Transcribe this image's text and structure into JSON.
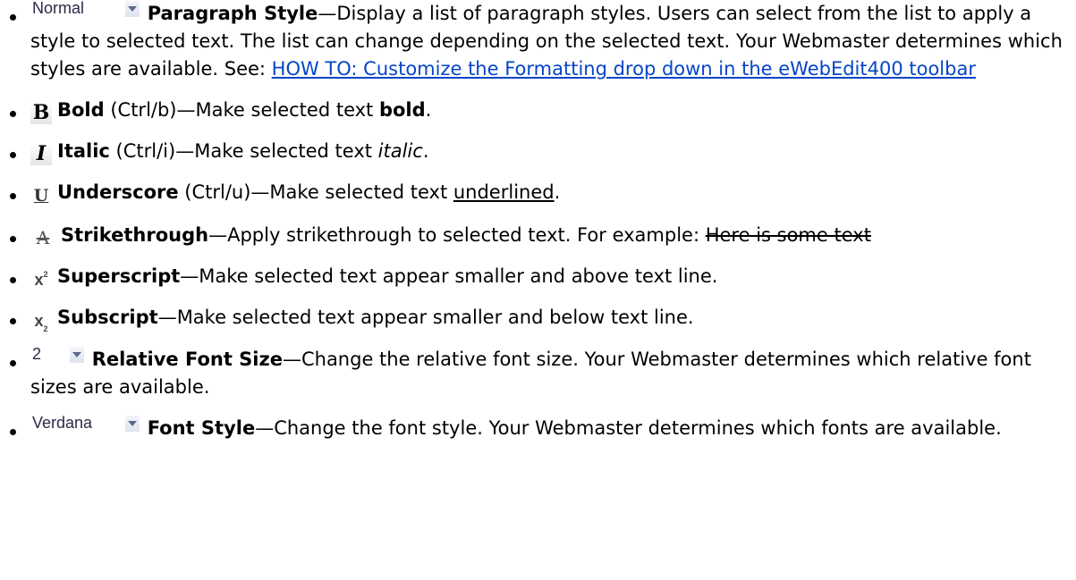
{
  "items": [
    {
      "widget": "Normal",
      "label": "Paragraph Style",
      "text": "—Display a list of paragraph styles. Users can select from the list to apply a style to selected text. The list can change depending on the selected text. Your Webmaster determines which styles are available. See: ",
      "link": "HOW TO: Customize the Formatting drop down in the eWebEdit400 toolbar"
    },
    {
      "label": "Bold",
      "shortcut": " (Ctrl/b)",
      "text": "—Make selected text ",
      "sample": "bold",
      "end": "."
    },
    {
      "label": "Italic",
      "shortcut": " (Ctrl/i)",
      "text": "—Make selected text ",
      "sample": "italic",
      "end": "."
    },
    {
      "label": "Underscore",
      "shortcut": " (Ctrl/u)",
      "text": "—Make selected text ",
      "sample": "underlined",
      "end": "."
    },
    {
      "label": "Strikethrough",
      "text": "—Apply strikethrough to selected text. For example: ",
      "sample": "Here is some text"
    },
    {
      "label": "Superscript",
      "text": "—Make selected text appear smaller and above text line."
    },
    {
      "label": "Subscript",
      "text": "—Make selected text appear smaller and below text line."
    },
    {
      "widget": "2",
      "label": "Relative Font Size",
      "text": "—Change the relative font size. Your Webmaster determines which relative font sizes are available."
    },
    {
      "widget": "Verdana",
      "label": "Font Style",
      "text": "—Change the font style. Your Webmaster determines which fonts are available."
    }
  ],
  "icons": {
    "bold": "B",
    "italic": "I",
    "underline": "U",
    "strike": "A",
    "superscript": "x",
    "subscript": "x"
  }
}
